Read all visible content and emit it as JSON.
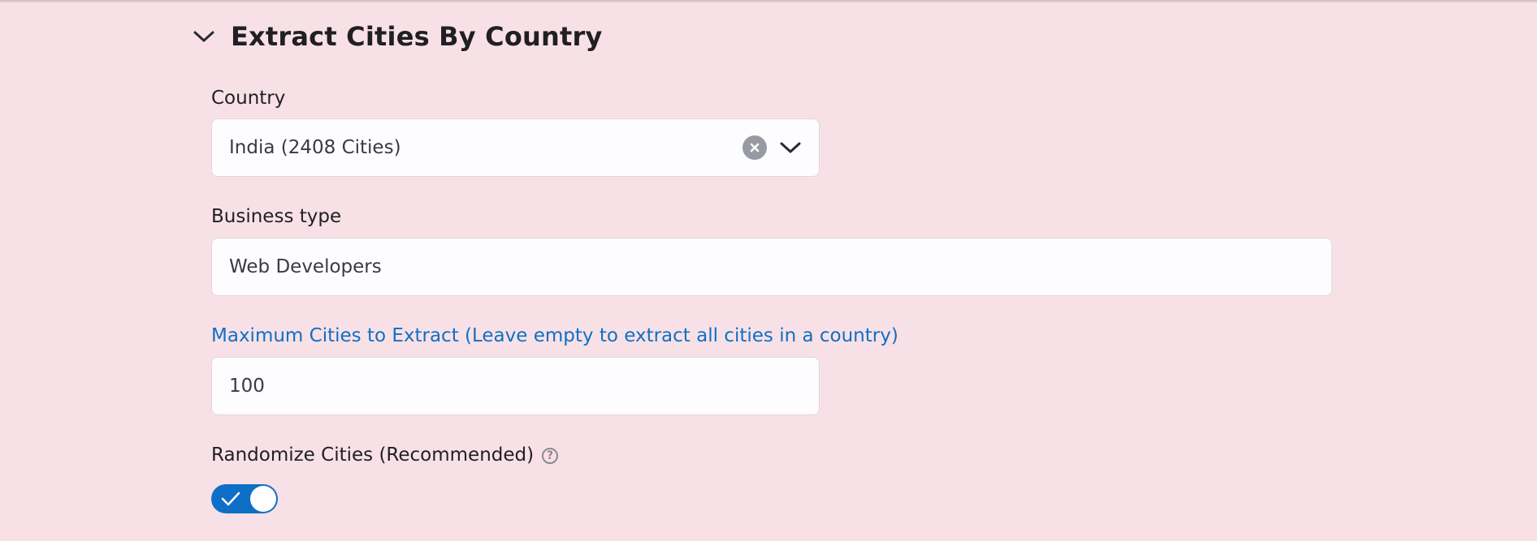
{
  "section": {
    "title": "Extract Cities By Country",
    "collapse_icon": "chevron-down-icon"
  },
  "country": {
    "label": "Country",
    "value": "India (2408 Cities)",
    "clear_icon": "clear-icon",
    "dropdown_icon": "chevron-down-icon"
  },
  "business_type": {
    "label": "Business type",
    "value": "Web Developers"
  },
  "max_cities": {
    "label": "Maximum Cities to Extract (Leave empty to extract all cities in a country)",
    "value": "100"
  },
  "randomize": {
    "label": "Randomize Cities (Recommended)",
    "help_icon": "help-icon",
    "help_glyph": "?",
    "enabled": true
  },
  "colors": {
    "background": "#f8e1e6",
    "accent": "#0f6fc6",
    "field_background": "#fdfcfe"
  }
}
